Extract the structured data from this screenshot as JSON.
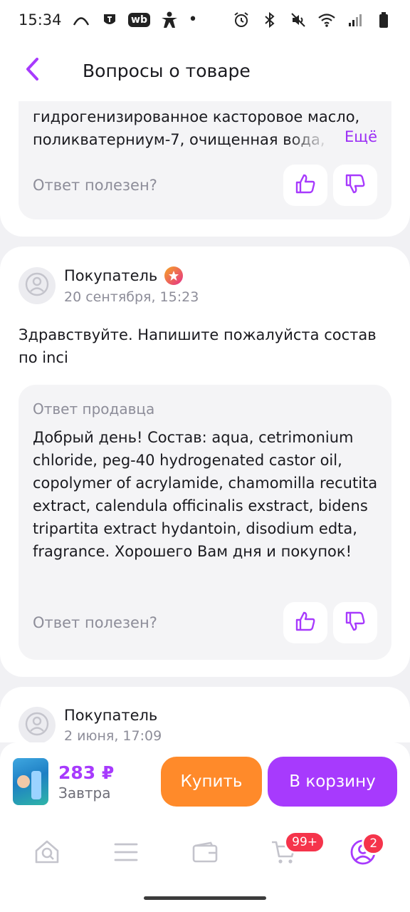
{
  "status_bar": {
    "time": "15:34",
    "icons_left": [
      "arc-icon",
      "shield-app-icon",
      "wb-app-icon",
      "person-app-icon",
      "dot-icon"
    ],
    "wb_text": "wb",
    "icons_right": [
      "alarm-icon",
      "bluetooth-icon",
      "mute-icon",
      "wifi-icon",
      "signal-icon",
      "battery-icon"
    ]
  },
  "header": {
    "title": "Вопросы о товаре"
  },
  "colors": {
    "accent": "#a73afd",
    "orange": "#ff8a2a",
    "badge": "#f5344b"
  },
  "card_1": {
    "answer_text": "гидрогенизированное касторовое масло, поликватерниум-7, очищенная вода,",
    "more_label": "Ещё",
    "helpful_label": "Ответ полезен?"
  },
  "card_2": {
    "author": "Покупатель",
    "date": "20 сентября, 15:23",
    "question": "Здравствуйте. Напишите пожалуйста состав по inci",
    "answer_label": "Ответ продавца",
    "answer_text": "Добрый день! Состав: aqua, cetrimonium chloride, peg-40 hydrogenated castor oil, copolymer of acrylamide, chamomilla recutita extract, calendula officinalis exstract, bidens tripartita extract hydantoin, disodium edta, fragrance. Хорошего Вам дня и покупок!",
    "helpful_label": "Ответ полезен?"
  },
  "card_3": {
    "author": "Покупатель",
    "date": "2 июня, 17:09"
  },
  "buy_bar": {
    "price": "283 ₽",
    "delivery": "Завтра",
    "buy_label": "Купить",
    "cart_label": "В корзину"
  },
  "bottom_nav": {
    "items": [
      "home-icon",
      "catalog-icon",
      "wallet-icon",
      "cart-icon",
      "profile-icon"
    ],
    "cart_badge": "99+",
    "profile_badge": "2"
  }
}
